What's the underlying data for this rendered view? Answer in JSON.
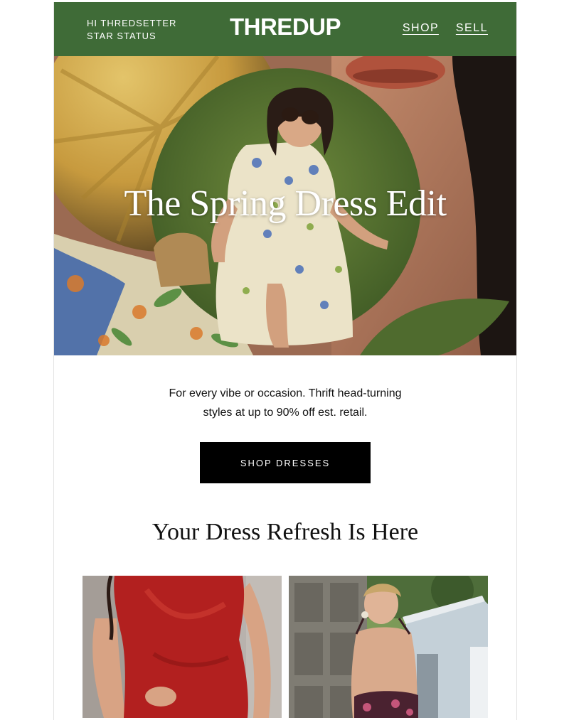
{
  "header": {
    "greeting_line1": "HI THREDSETTER",
    "greeting_line2": "STAR STATUS",
    "logo": "THREDUP",
    "nav": {
      "shop": "SHOP",
      "sell": "SELL"
    },
    "bg_color": "#3f6b37"
  },
  "hero": {
    "title": "The Spring Dress Edit"
  },
  "intro": {
    "line1": "For every vibe or occasion. Thrift head-turning",
    "line2": "styles at up to 90% off est. retail."
  },
  "cta": {
    "label": "SHOP DRESSES"
  },
  "section": {
    "title": "Your Dress Refresh Is Here"
  },
  "products": [
    {
      "name": "red-satin-dress"
    },
    {
      "name": "floral-backless-dress"
    }
  ]
}
